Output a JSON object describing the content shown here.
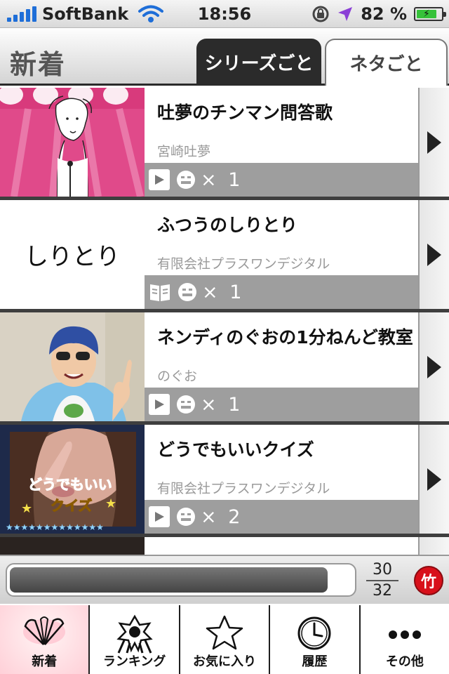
{
  "status_bar": {
    "carrier": "SoftBank",
    "time": "18:56",
    "battery": "82 %",
    "battery_level": 0.82
  },
  "nav": {
    "title": "新着",
    "segments": [
      {
        "label": "シリーズごと",
        "selected": true
      },
      {
        "label": "ネタごと",
        "selected": false
      }
    ]
  },
  "list": {
    "items": [
      {
        "title": "吐夢のチンマン問答歌",
        "author": "宮崎吐夢",
        "media": "video-icon",
        "count": "× 1"
      },
      {
        "title": "ふつうのしりとり",
        "author": "有限会社プラスワンデジタル",
        "media": "book-icon",
        "count": "× 1",
        "thumb_text": "しりとり"
      },
      {
        "title": "ネンディのぐおの1分ねんど教室",
        "author": "のぐお",
        "media": "video-icon",
        "count": "× 1"
      },
      {
        "title": "どうでもいいクイズ",
        "author": "有限会社プラスワンデジタル",
        "media": "video-icon",
        "count": "× 2",
        "thumb_text_1": "どうでもいい",
        "thumb_text_2": "クイズ"
      }
    ]
  },
  "player": {
    "progress": 0.93,
    "current": "30",
    "total": "32",
    "button_label": "竹"
  },
  "tabs": [
    {
      "label": "新着",
      "icon": "new-arrivals-icon",
      "active": true
    },
    {
      "label": "ランキング",
      "icon": "ranking-icon",
      "active": false
    },
    {
      "label": "お気に入り",
      "icon": "star-icon",
      "active": false
    },
    {
      "label": "履歴",
      "icon": "clock-icon",
      "active": false
    },
    {
      "label": "その他",
      "icon": "more-icon",
      "active": false
    }
  ]
}
